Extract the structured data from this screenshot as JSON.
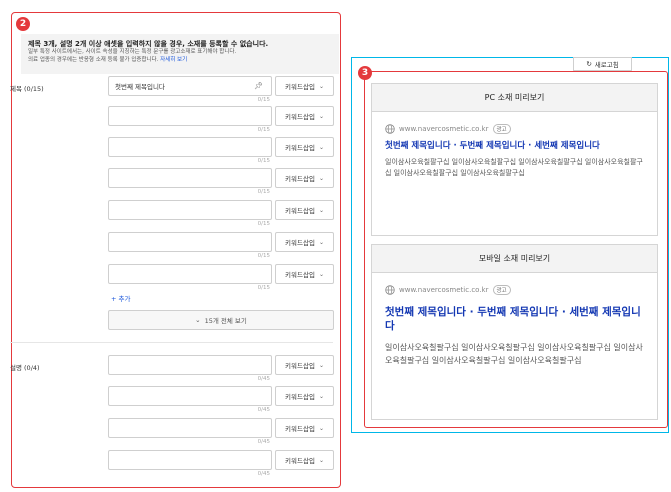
{
  "form": {
    "badge": "2",
    "notice": {
      "title": "제목 3개, 설명 2개 이상 애셋을 입력하지 않을 경우, 소재를 등록할 수 없습니다.",
      "line1": "일부 특정 사이트에서는, 사이트 속성을 지칭하는 특정 문구를 광고소재로 표기해야 합니다.",
      "line2": "의료 업종의 경우에는 반응형 소재 등록 불가 입증합니다.",
      "link": "자세히 보기"
    },
    "title_label": "제목 (0/15)",
    "desc_label": "설명 (0/4)",
    "keyword_button": "키워드삽입",
    "title_rows": [
      {
        "value": "첫번째 제목입니다",
        "counter": "0/15"
      },
      {
        "value": "",
        "counter": "0/15"
      },
      {
        "value": "",
        "counter": "0/15"
      },
      {
        "value": "",
        "counter": "0/15"
      },
      {
        "value": "",
        "counter": "0/15"
      },
      {
        "value": "",
        "counter": "0/15"
      },
      {
        "value": "",
        "counter": "0/15"
      }
    ],
    "add_label": "+ 추가",
    "view_all": "15개 전체 보기",
    "desc_rows": [
      {
        "value": "",
        "counter": "0/45"
      },
      {
        "value": "",
        "counter": "0/45"
      },
      {
        "value": "",
        "counter": "0/45"
      },
      {
        "value": "",
        "counter": "0/45"
      }
    ]
  },
  "preview": {
    "refresh_label": "새로고침",
    "badge": "3",
    "pc": {
      "header": "PC 소재 미리보기",
      "url": "www.navercosmetic.co.kr",
      "ad_tag": "광고",
      "title": "첫번째 제목입니다 · 두번째 제목입니다 · 세번째 제목입니다",
      "desc": "일이삼사오육칠팔구십 일이삼사오육칠팔구십 일이삼사오육칠팔구십 일이삼사오육칠팔구십 일이삼사오육칠팔구십 일이삼사오육칠팔구십"
    },
    "mobile": {
      "header": "모바일 소재 미리보기",
      "url": "www.navercosmetic.co.kr",
      "ad_tag": "광고",
      "title": "첫번째 제목입니다 · 두번째 제목입니다 · 세번째 제목입니다",
      "desc": "일이삼사오육칠팔구십 일이삼사오육칠팔구십 일이삼사오육칠팔구십 일이삼사오육칠팔구십 일이삼사오육칠팔구십 일이삼사오육칠팔구십"
    }
  }
}
